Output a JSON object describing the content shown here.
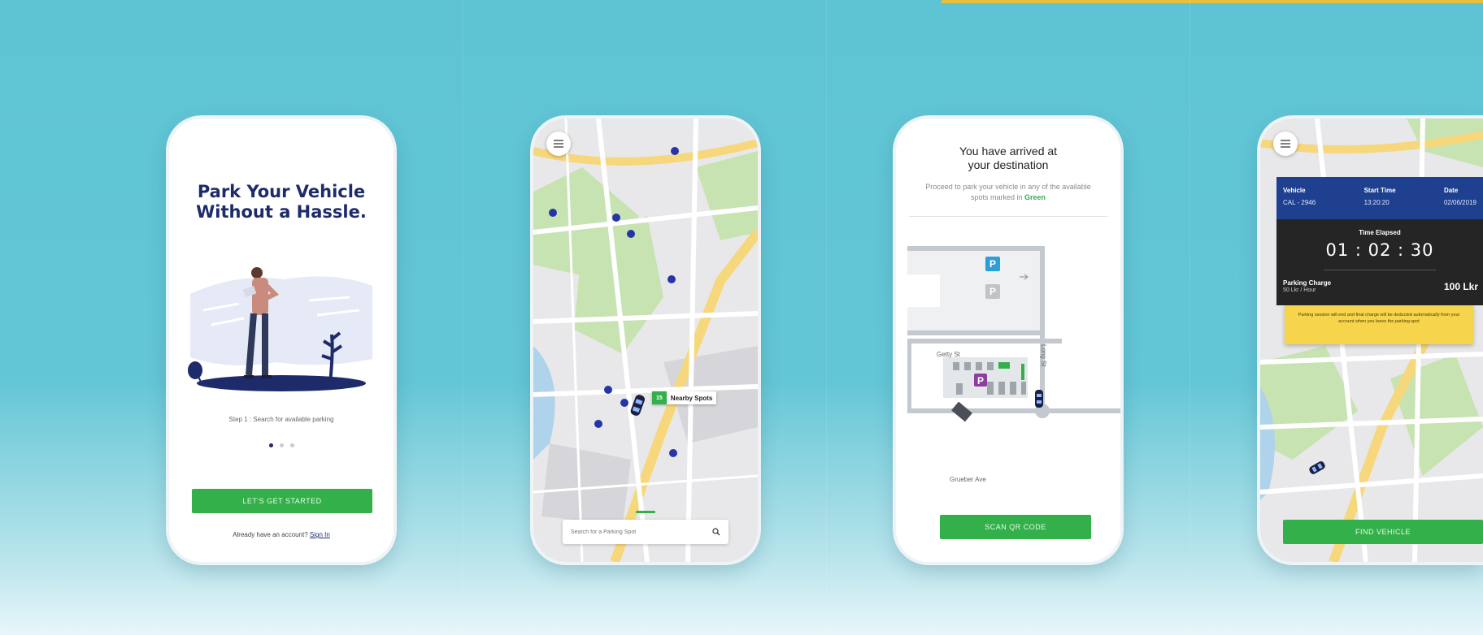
{
  "colors": {
    "accent_green": "#33b04a",
    "brand_navy": "#1d2b6b",
    "info_blue": "#1f3f8f",
    "notice_yellow": "#f6d44c",
    "background_teal": "#5ec4d4"
  },
  "screens": {
    "onboarding": {
      "title_line1": "Park Your Vehicle",
      "title_line2": "Without a Hassle.",
      "step_text": "Step 1 : Search for available parking",
      "pagination": {
        "total": 3,
        "active": 1
      },
      "cta_label": "LET'S GET STARTED",
      "signin_prompt": "Already have an account?",
      "signin_link": "Sign In"
    },
    "map_search": {
      "menu_icon": "hamburger-icon",
      "nearby_count": "15",
      "nearby_label": "Nearby Spots",
      "search_placeholder": "Search for a Parking Spot",
      "search_icon": "search-icon"
    },
    "arrival": {
      "title_line1": "You have arrived at",
      "title_line2": "your destination",
      "subtitle_prefix": "Proceed to park your vehicle in any of the available spots marked in",
      "subtitle_highlight": "Green",
      "streets": [
        "Getty St",
        "Long St",
        "Grueber Ave"
      ],
      "cta_label": "SCAN QR CODE"
    },
    "session": {
      "menu_icon": "hamburger-icon",
      "vehicle_header": "Vehicle",
      "vehicle_value": "CAL - 2946",
      "start_header": "Start Time",
      "start_value": "13:20:20",
      "date_header": "Date",
      "date_value": "02/06/2019",
      "elapsed_label": "Time Elapsed",
      "elapsed_value": "01 : 02 : 30",
      "charge_label": "Parking Charge",
      "charge_rate": "50 Lkr / Hour",
      "charge_value": "100 Lkr",
      "notice_text": "Parking session will end and final charge will be deducted automatically from your account when you leave the parking spot",
      "cta_label": "FIND VEHICLE"
    }
  }
}
